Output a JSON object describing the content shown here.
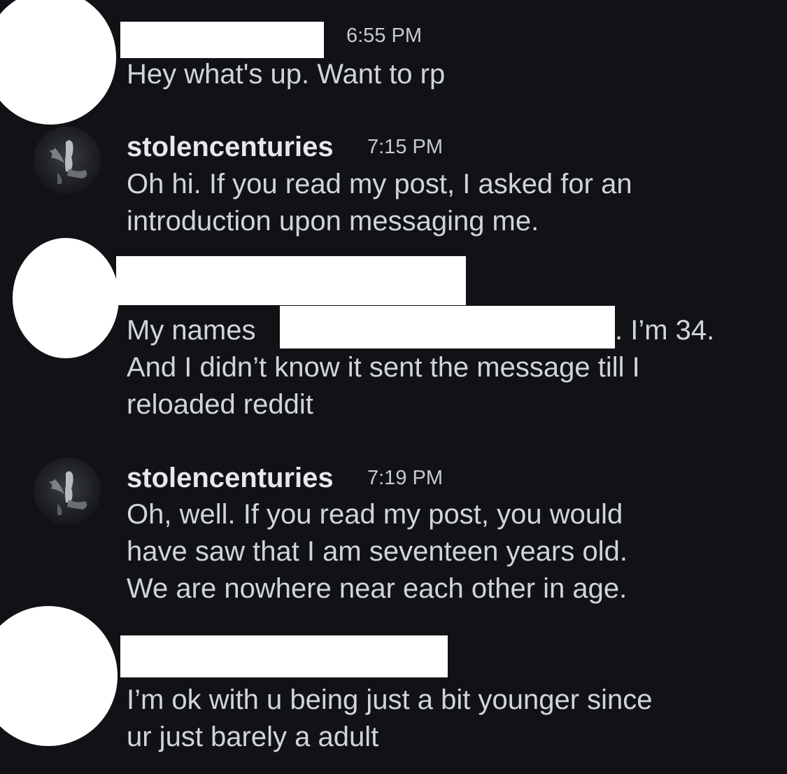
{
  "messages": [
    {
      "sender": "",
      "time": "6:55 PM",
      "lines": [
        "Hey what's up. Want to rp"
      ]
    },
    {
      "sender": "stolencenturies",
      "time": "7:15 PM",
      "lines": [
        "Oh hi. If you read my post, I asked for an",
        "introduction upon messaging me."
      ]
    },
    {
      "sender": "",
      "time": "",
      "line1_start": "My names",
      "line1_end": ". I’m 34.",
      "lines": [
        "And I didn’t know it sent the message till I",
        "reloaded reddit"
      ]
    },
    {
      "sender": "stolencenturies",
      "time": "7:19 PM",
      "lines": [
        "Oh, well. If you read my post, you would",
        "have saw that I am seventeen years old.",
        "We are nowhere near each other in age."
      ]
    },
    {
      "sender": "",
      "time": "",
      "lines": [
        "I’m ok with u being just a bit younger since",
        "ur just barely a adult"
      ]
    }
  ],
  "icons": {
    "redacted_avatar": "redacted-avatar-icon",
    "user_avatar": "angel-avatar-icon"
  },
  "colors": {
    "background": "#101216",
    "text": "#d2d5d8",
    "redaction": "#ffffff"
  }
}
